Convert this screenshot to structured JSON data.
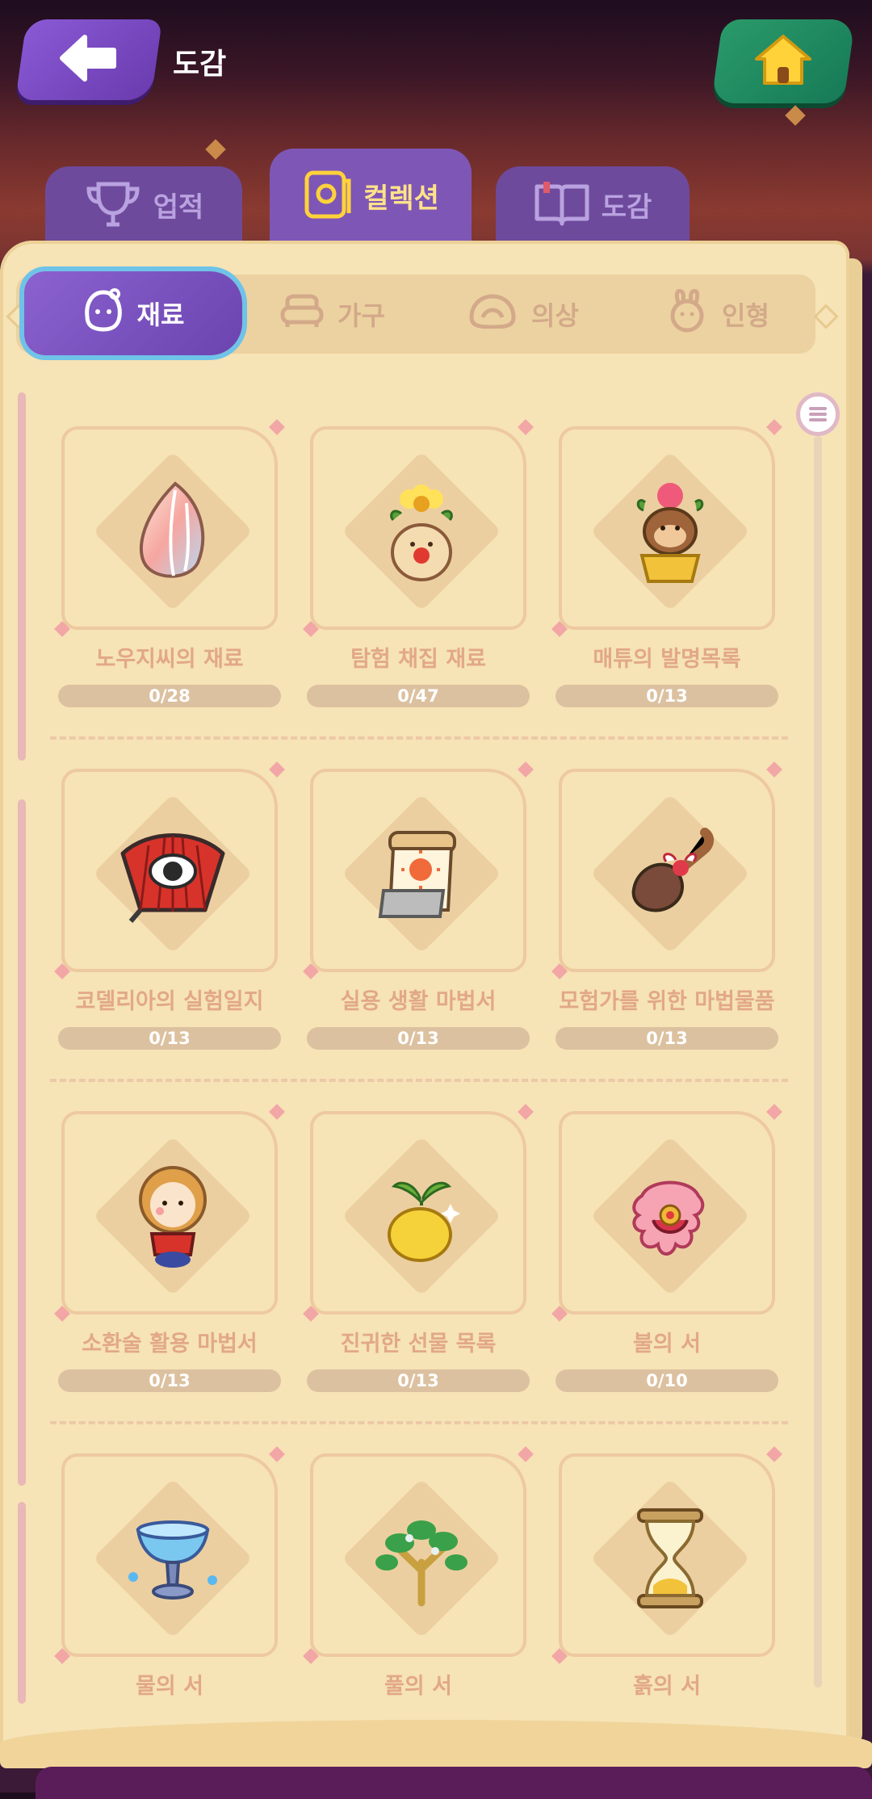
{
  "header": {
    "title": "도감"
  },
  "main_tabs": [
    {
      "label": "업적",
      "icon": "trophy-icon",
      "active": false
    },
    {
      "label": "컬렉션",
      "icon": "collection-book-icon",
      "active": true
    },
    {
      "label": "도감",
      "icon": "open-book-icon",
      "active": false
    }
  ],
  "sub_tabs": [
    {
      "label": "재료",
      "icon": "material-blob-icon",
      "active": true
    },
    {
      "label": "가구",
      "icon": "sofa-icon",
      "active": false
    },
    {
      "label": "의상",
      "icon": "hat-icon",
      "active": false
    },
    {
      "label": "인형",
      "icon": "bunny-doll-icon",
      "active": false
    }
  ],
  "collections": [
    {
      "name": "노우지씨의 재료",
      "progress": "0/28",
      "icon": "feather-seed-icon"
    },
    {
      "name": "탐험 채집 재료",
      "progress": "0/47",
      "icon": "mandrake-flower-icon"
    },
    {
      "name": "매튜의 발명목록",
      "progress": "0/13",
      "icon": "monkey-pot-icon"
    },
    {
      "name": "코델리아의 실험일지",
      "progress": "0/13",
      "icon": "eye-fan-icon"
    },
    {
      "name": "실용 생활 마법서",
      "progress": "0/13",
      "icon": "calendar-scroll-icon"
    },
    {
      "name": "모험가를 위한 마법물품",
      "progress": "0/13",
      "icon": "bow-brush-icon"
    },
    {
      "name": "소환술 활용 마법서",
      "progress": "0/13",
      "icon": "hooded-doll-icon"
    },
    {
      "name": "진귀한 선물 목록",
      "progress": "0/13",
      "icon": "golden-seed-icon"
    },
    {
      "name": "불의 서",
      "progress": "0/10",
      "icon": "fire-feather-icon"
    },
    {
      "name": "물의 서",
      "progress": "",
      "icon": "water-chalice-icon"
    },
    {
      "name": "풀의 서",
      "progress": "",
      "icon": "leaf-tree-icon"
    },
    {
      "name": "흙의 서",
      "progress": "",
      "icon": "hourglass-icon"
    }
  ],
  "colors": {
    "accent_purple": "#7e56b6",
    "home_green": "#1f8a5e",
    "panel": "#f6e3b6",
    "label": "#e2a886"
  }
}
